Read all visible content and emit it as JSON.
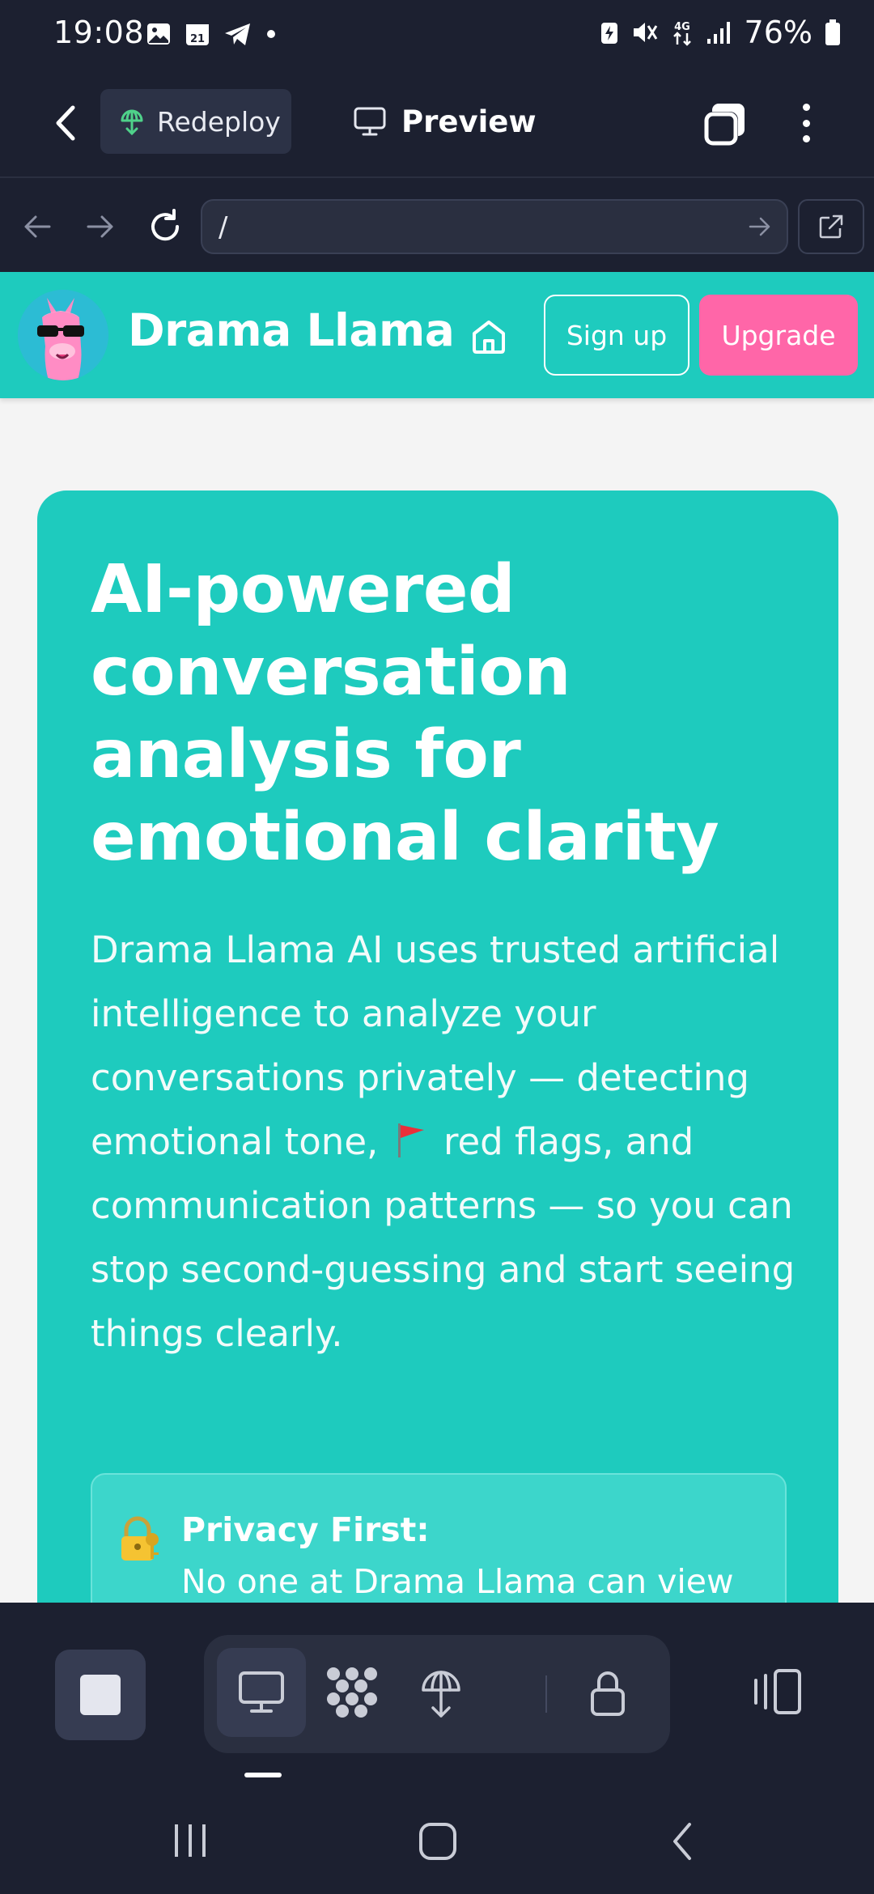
{
  "status_bar": {
    "time": "19:08",
    "calendar_day": "21",
    "network": "4G",
    "battery": "76%",
    "icons": [
      "gallery-icon",
      "calendar-icon",
      "telegram-icon",
      "dot-icon",
      "battery-saver-icon",
      "mute-icon",
      "data-4g-icon",
      "signal-icon",
      "battery-icon"
    ]
  },
  "app_toolbar": {
    "redeploy_label": "Redeploy",
    "preview_label": "Preview"
  },
  "browser": {
    "url": "/"
  },
  "site": {
    "brand": "Drama Llama",
    "signup_label": "Sign up",
    "upgrade_label": "Upgrade",
    "colors": {
      "primary": "#1ecbbe",
      "accent": "#ff66a8"
    }
  },
  "hero": {
    "title": "AI-powered conversation analysis for emotional clarity",
    "description_before_flag": "Drama Llama AI uses trusted artificial intelligence to analyze your conversations privately — detecting emotional tone,",
    "description_after_flag": "red flags, and communication patterns — so you can stop second-guessing and start seeing things clearly."
  },
  "privacy": {
    "title": "Privacy First:",
    "text": "No one at Drama Llama can view"
  },
  "bottom_bar": {
    "items": [
      "stop-button",
      "desktop-view",
      "integrations",
      "deploy",
      "lock",
      "device-toggle"
    ]
  }
}
